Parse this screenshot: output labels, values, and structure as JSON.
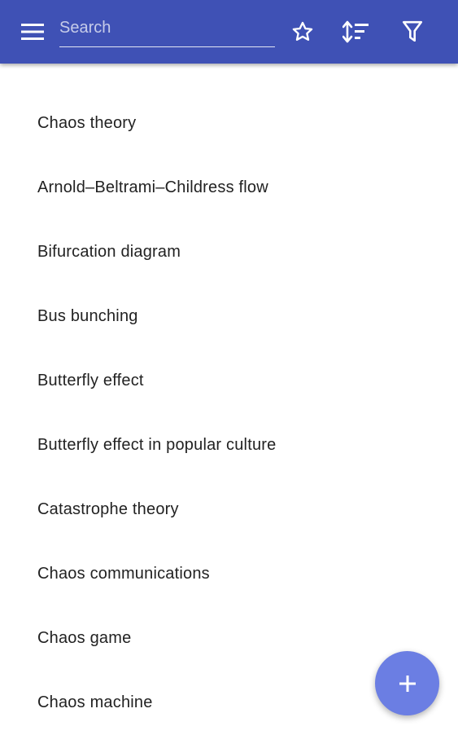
{
  "app_bar": {
    "menu_icon": "menu-icon",
    "search": {
      "placeholder": "Search",
      "value": ""
    },
    "actions": [
      {
        "icon": "star-outline-icon"
      },
      {
        "icon": "sort-icon"
      },
      {
        "icon": "filter-icon"
      }
    ],
    "background_color": "#3f51b5"
  },
  "articles": [
    {
      "title": "Chaos theory"
    },
    {
      "title": "Arnold–Beltrami–Childress flow"
    },
    {
      "title": "Bifurcation diagram"
    },
    {
      "title": "Bus bunching"
    },
    {
      "title": "Butterfly effect"
    },
    {
      "title": "Butterfly effect in popular culture"
    },
    {
      "title": "Catastrophe theory"
    },
    {
      "title": "Chaos communications"
    },
    {
      "title": "Chaos game"
    },
    {
      "title": "Chaos machine"
    }
  ],
  "fab": {
    "icon": "plus-icon",
    "color": "#6b7ee3"
  }
}
